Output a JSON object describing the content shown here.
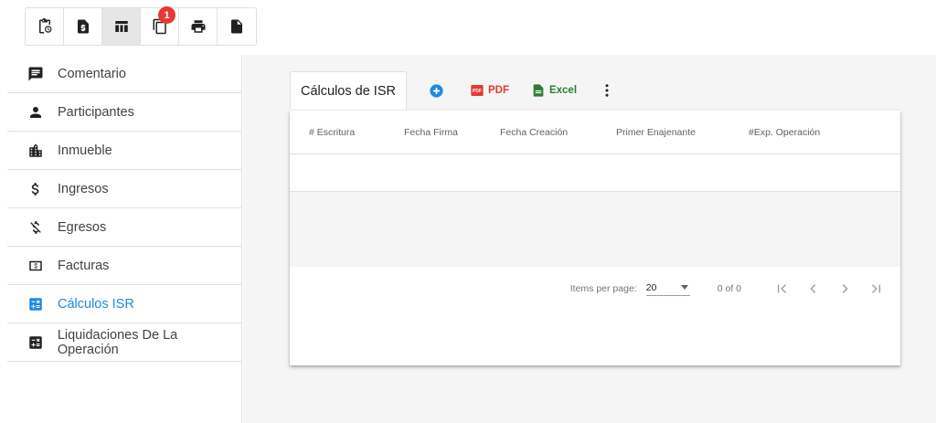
{
  "toolbar": {
    "buttons": [
      {
        "icon": "clipboard-clock-icon"
      },
      {
        "icon": "file-dollar-icon"
      },
      {
        "icon": "table-icon",
        "active": true
      },
      {
        "icon": "copy-icon",
        "badge": "1"
      },
      {
        "icon": "print-icon"
      },
      {
        "icon": "file-icon"
      }
    ]
  },
  "sidebar": {
    "items": [
      {
        "label": "Comentario",
        "icon": "comment-icon"
      },
      {
        "label": "Participantes",
        "icon": "person-icon"
      },
      {
        "label": "Inmueble",
        "icon": "building-icon"
      },
      {
        "label": "Ingresos",
        "icon": "dollar-icon"
      },
      {
        "label": "Egresos",
        "icon": "money-off-icon"
      },
      {
        "label": "Facturas",
        "icon": "invoice-icon"
      },
      {
        "label": "Cálculos ISR",
        "icon": "calculator-icon",
        "active": true
      },
      {
        "label": "Liquidaciones De La Operación",
        "icon": "calculator-icon"
      }
    ]
  },
  "main": {
    "tab_label": "Cálculos de ISR",
    "pdf_label": "PDF",
    "excel_label": "Excel",
    "columns": [
      "# Escritura",
      "Fecha Firma",
      "Fecha Creación",
      "Primer Enajenante",
      "#Exp. Operación"
    ],
    "paginator": {
      "items_per_page_label": "Items per page:",
      "items_per_page_value": "20",
      "range_label": "0 of 0"
    }
  },
  "colors": {
    "accent": "#1e88e5",
    "badge": "#e53935",
    "pdf": "#e53935",
    "excel": "#2e7d32"
  }
}
